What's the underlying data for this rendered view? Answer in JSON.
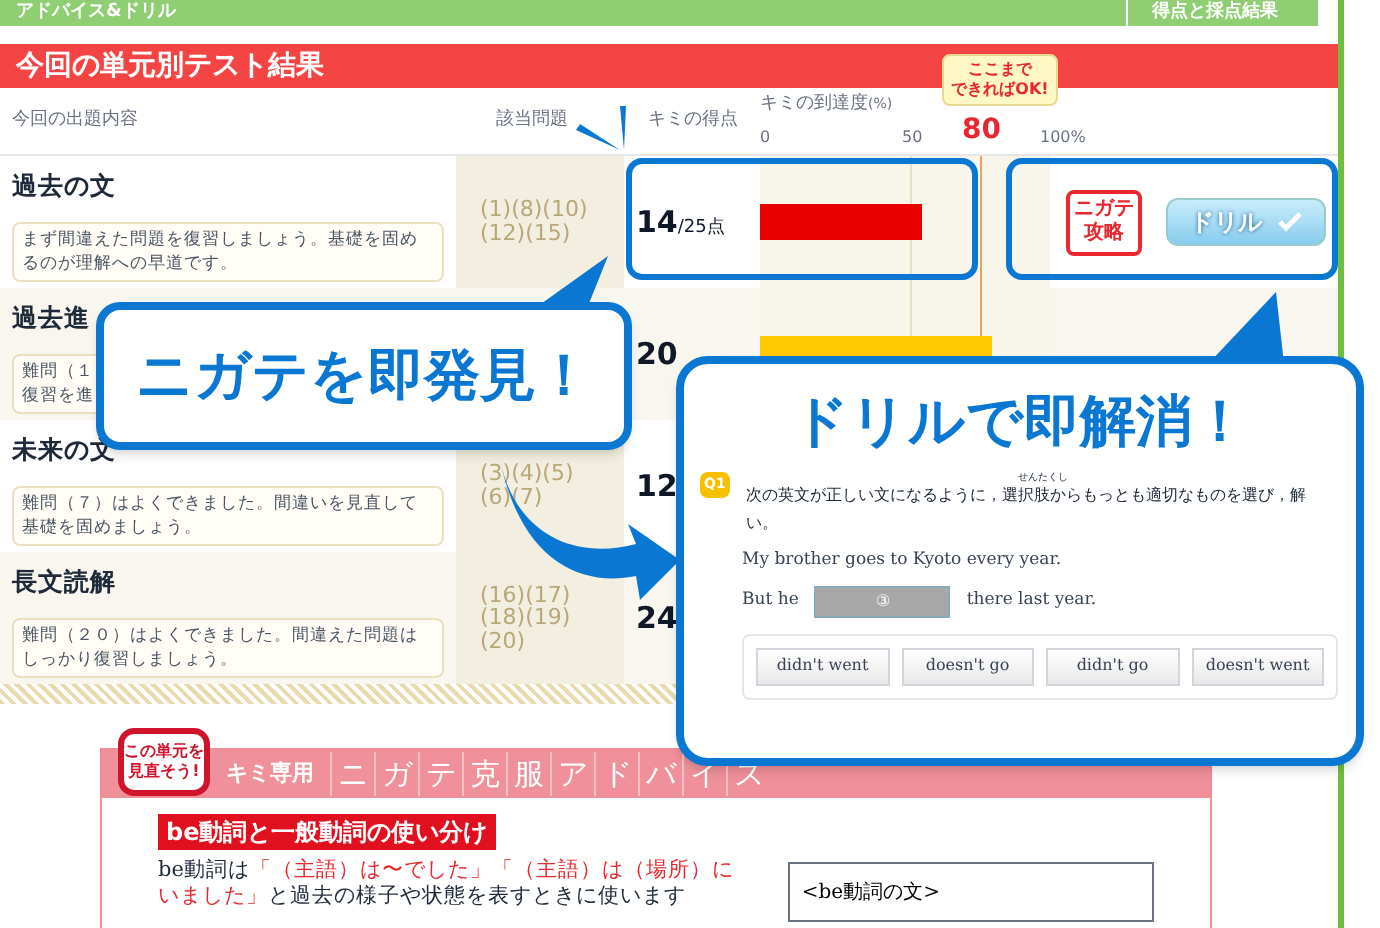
{
  "top_bar": {
    "title": "アドバイス&ドリル",
    "tab": "得点と採点結果"
  },
  "results": {
    "title": "今回の単元別テスト結果",
    "columns": [
      "今回の出題内容",
      "該当問題",
      "キミの得点",
      "キミの到達度"
    ],
    "unit": "(%)",
    "ticks": [
      "0",
      "50",
      "100%"
    ],
    "target": "80",
    "target_note": "ここまで",
    "target_note_2": "できればOK!",
    "rows": [
      {
        "topic": "過去の文",
        "advice": "まず間違えた問題を復習しましょう。基礎を固めるのが理解への早道です。",
        "problems": "(1)(8)(10)(12)(15)",
        "score": "14",
        "total": "/25点",
        "level": 0.56,
        "color": "#e80000",
        "stamp": "ニガテ攻略",
        "drill": "ドリル"
      },
      {
        "topic": "過去進",
        "advice": "難問（１",
        "advice_2": "復習を進",
        "score": "20",
        "level": 0.8,
        "color": "#ffc800"
      },
      {
        "topic": "未来の文",
        "advice": "難問（７）はよくできました。間違いを見直して基礎を固めましょう。",
        "problems": "(3)(4)(5)(6)(7)",
        "score": "12"
      },
      {
        "topic": "長文読解",
        "advice": "難問（２０）はよくできました。間違えた問題はしっかり復習しましょう。",
        "problems": "(16)(17)(18)(19)(20)",
        "score": "24"
      }
    ]
  },
  "callout_find": "ニガテを即発見！",
  "drill_panel": {
    "title": "ドリルで即解消！",
    "number": "Q1",
    "ruby": "せんたくし",
    "instruction": "次の英文が正しい文になるように，選択肢からもっとも適切なものを選び，解",
    "instruction_2": "い。",
    "sentence_1": "My brother goes to Kyoto every year.",
    "sentence_2_start": "But he",
    "blank": "③",
    "sentence_2_end": "there last year.",
    "choices": [
      {
        "label": "didn't went",
        "selected": false
      },
      {
        "label": "doesn't go",
        "selected": false
      },
      {
        "label": "didn't go",
        "selected": false
      },
      {
        "label": "doesn't went",
        "selected": false
      }
    ]
  },
  "advice": {
    "stamp": "この単元を見直そう!",
    "tag": "キミ専用",
    "heading_chars": [
      "ニ",
      "ガ",
      "テ",
      "克",
      "服",
      "ア",
      "ド",
      "バ",
      "イ",
      "ス"
    ],
    "subtitle": "be動詞と一般動詞の使い分け",
    "paragraph": [
      {
        "text": "be動詞は",
        "kind": "plain"
      },
      {
        "text": "「（主語）は〜でした」「（主語）は（場所）にいました」",
        "kind": "emphasis"
      },
      {
        "text": "と過去の様子や状態を表すときに使います",
        "kind": "plain"
      }
    ],
    "example_title": "<be動詞の文>"
  }
}
